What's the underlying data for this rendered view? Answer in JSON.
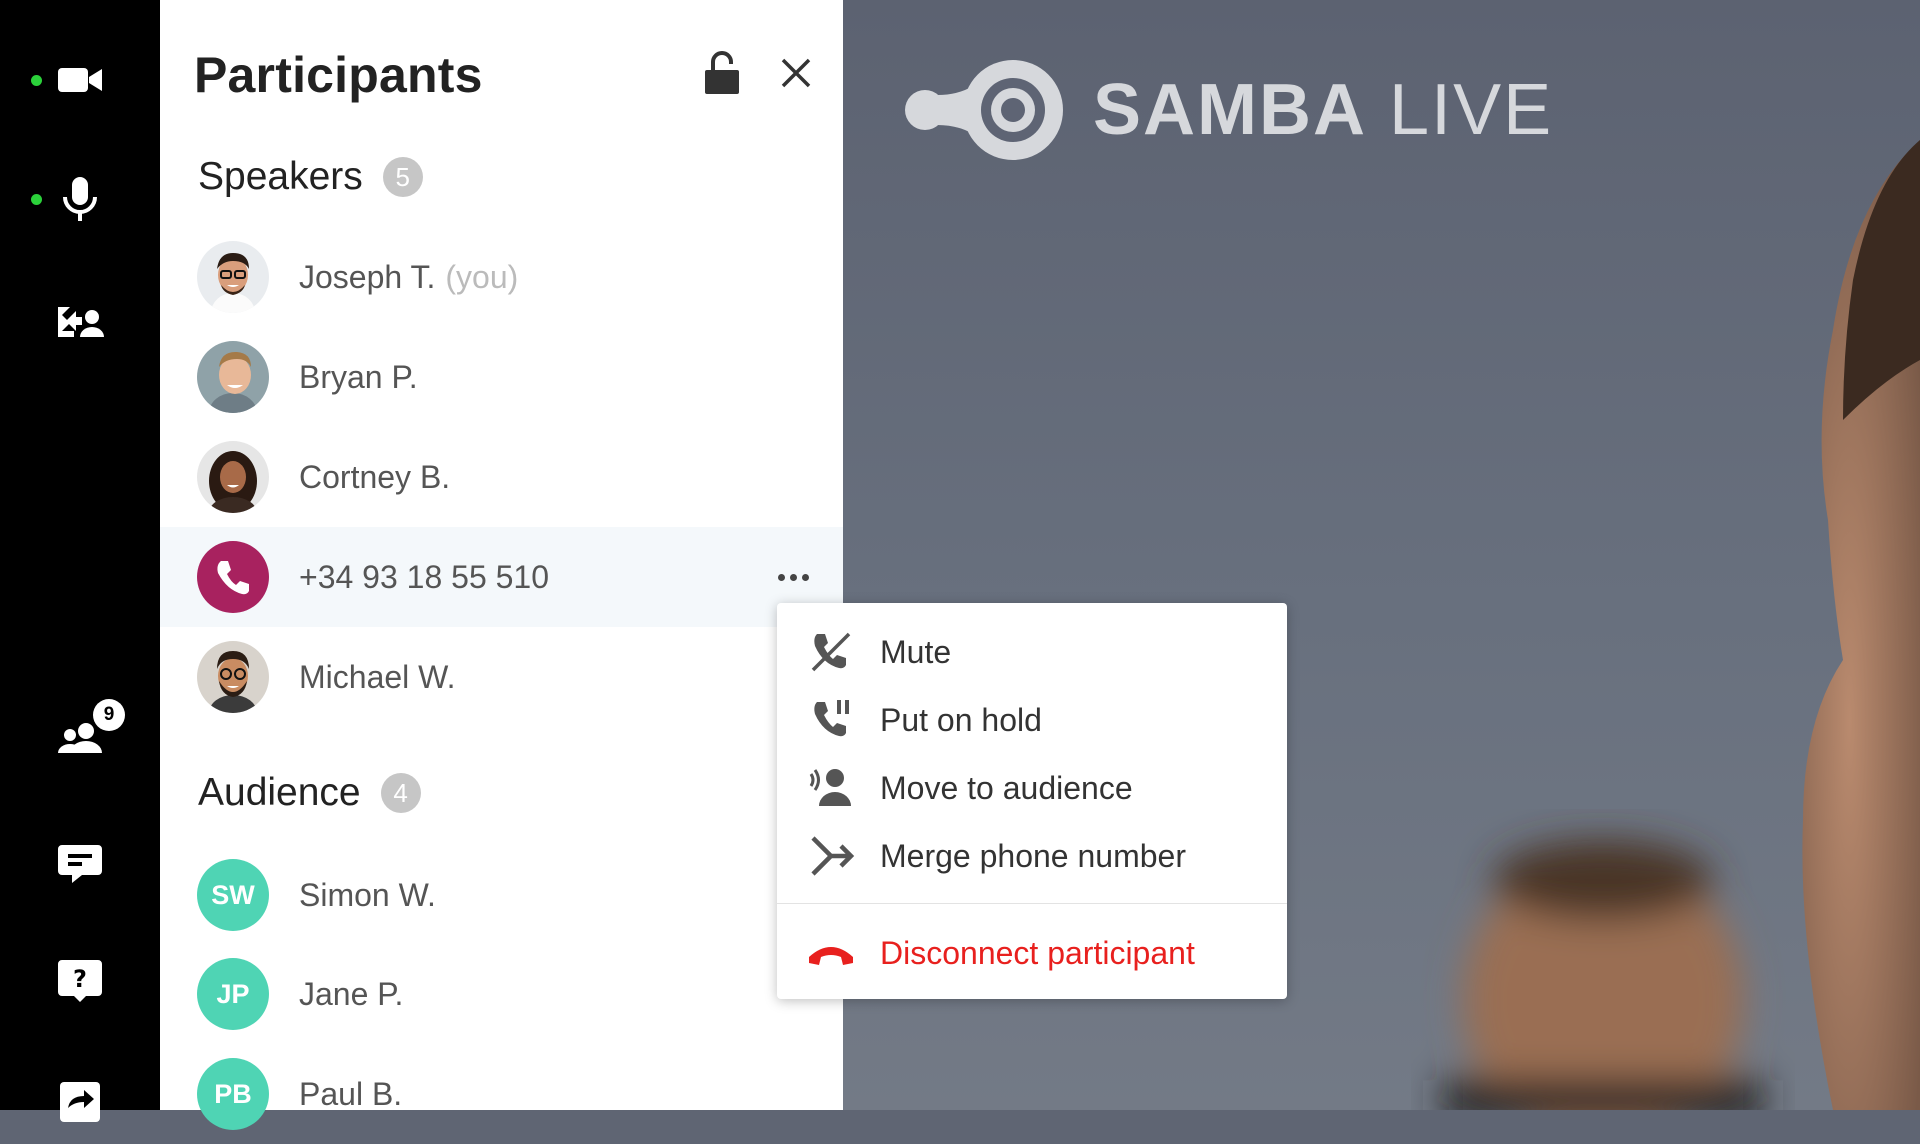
{
  "rail": {
    "participants_count": "9",
    "icons": [
      "video-camera-icon",
      "microphone-icon",
      "share-screen-icon",
      "participants-icon",
      "chat-icon",
      "help-icon",
      "share-icon"
    ],
    "active_dot_color": "#2bd13a"
  },
  "panel": {
    "title": "Participants",
    "speakers": {
      "label": "Speakers",
      "count": "5",
      "items": [
        {
          "name": "Joseph T.",
          "suffix": "(you)"
        },
        {
          "name": "Bryan P."
        },
        {
          "name": "Cortney B."
        },
        {
          "name": "+34 93 18 55 510"
        },
        {
          "name": "Michael W."
        }
      ]
    },
    "audience": {
      "label": "Audience",
      "count": "4",
      "items": [
        {
          "name": "Simon W.",
          "initials": "SW"
        },
        {
          "name": "Jane P.",
          "initials": "JP"
        },
        {
          "name": "Paul B.",
          "initials": "PB"
        }
      ]
    }
  },
  "video": {
    "brand_bold": "SAMBA",
    "brand_light": "LIVE"
  },
  "context_menu": {
    "items": [
      {
        "label": "Mute",
        "icon": "phone-muted-icon"
      },
      {
        "label": "Put on hold",
        "icon": "phone-hold-icon"
      },
      {
        "label": "Move to audience",
        "icon": "move-to-audience-icon"
      },
      {
        "label": "Merge phone number",
        "icon": "merge-icon"
      }
    ],
    "danger": {
      "label": "Disconnect participant",
      "icon": "hang-up-icon",
      "color": "#e8201e"
    }
  },
  "colors": {
    "phone_avatar": "#a8225f",
    "initials_avatar": "#4fd4b4"
  }
}
